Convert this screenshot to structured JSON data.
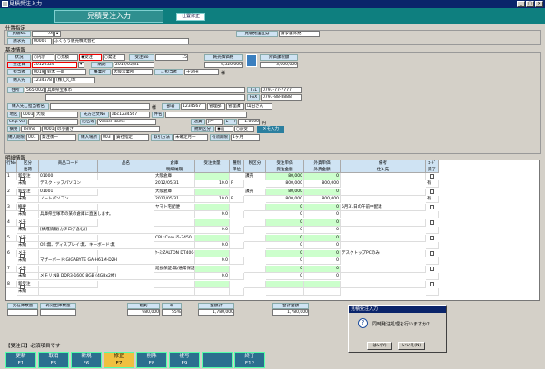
{
  "window": {
    "title": "見積受注入力",
    "min": "_",
    "max": "□",
    "close": "×"
  },
  "header": {
    "title": "見積受注入力",
    "mode": "仕置修正"
  },
  "sec_client": {
    "title": "仕置指定",
    "hinban_label": "見積No",
    "hinban_val": "24",
    "kyoten_label": "請求先",
    "kyoten_code": "00001",
    "kyoten_name": "ふくろう販売株式会社",
    "bunrui_label": "見積発送区分",
    "bunrui_val": "請求書外発"
  },
  "sec_basic": {
    "title": "基本情報",
    "status_label": "状況",
    "status_opts": [
      "内示",
      "見積",
      "受注",
      "発注"
    ],
    "juchu_no_label": "受注No",
    "juchu_no": "15",
    "kingaku_label": "純売価価格",
    "kingaku": "4,520,000",
    "zei_label": "外価課税額",
    "zei": "3,000,000",
    "uketsuke_label": "受注日",
    "uketsuke": "20120524",
    "nouki_label": "納期",
    "nouki": "2012/05/31",
    "tanto_label": "担当者",
    "tanto_code": "0019",
    "tanto_name": "鈴木 一郎",
    "jigyo_label": "事業所",
    "jigyo_val": "大阪営業所",
    "kokyaku_label": "ご担当者",
    "kokyaku_val": "千津田",
    "sama": "様",
    "nonyu_label": "納入先",
    "nonyu_code": "1234578",
    "nonyu_name": "(株)〇〇本",
    "addr_label": "住所",
    "zip": "565-0022",
    "addr": "兵庫県宝塚市",
    "tel_label": "TEL",
    "tel": "0797-77-7777",
    "fax_label": "FAX",
    "fax": "0797-88-8888",
    "nonyu_tanto_label": "納入先ご担当者名",
    "nonyu_tanto_sama": "様",
    "busho_label": "部署",
    "busho_code": "1234567",
    "busho_name": "管理部",
    "yakushoku": "管理課",
    "yakushoku_name": "山田さん",
    "chiku_label": "地区",
    "chiku_code": "0001",
    "chiku_name": "大阪",
    "senpo_label": "先方注文No",
    "senpo_val": "abc1234567",
    "kenmei_label": "件名",
    "ship_label": "Ship Via",
    "ship_val": "",
    "vessel_label": "船名等",
    "vessel_val": "Vessel Name",
    "tsuka_label": "通貨",
    "tsuka_val": "JPY",
    "rate_label": "レート",
    "rate_val": "1.0000",
    "en": "円",
    "tekiyo_label": "摘要",
    "tekiyo_val": "Terms",
    "tekiyo_code": "0001",
    "tekiyo_name": "の小書き",
    "saiken_label": "規制区分",
    "saiken_opts": [
      "前",
      "前受"
    ],
    "memo_btn": "メモ入力",
    "nonyu_kubun_label": "納入期限",
    "nonyu_kubun_code": "001",
    "nonyu_kubun_name": "発注後一",
    "nonyu_basho_label": "納入場所",
    "nonyu_basho_code": "003",
    "nonyu_basho_name": "貴社指定",
    "torihiki_label": "取引方法",
    "torihiki_val": "未確定月一",
    "yuko_label": "有効期限",
    "yuko_val": "1ヶ月"
  },
  "detail": {
    "title": "明細情報",
    "headers": {
      "no": "行No",
      "kubun": "区分\n出荷",
      "code": "商品コード",
      "name2": "品名２",
      "name": "品名",
      "unit": "倉庫\n明細納期",
      "qty": "受注数量",
      "shubetsu": "種別\n単位",
      "zei": "税区分",
      "tanka": "受注単価\n受注金額",
      "gaika": "外貨単価\n外貨金額",
      "biko": "備考\n仕入先",
      "chk": "ｺｰﾄﾞ\n完了"
    },
    "rows": [
      {
        "no": "1",
        "kubun": "新受注",
        "shuka": "未納",
        "code": "01000",
        "name": "デスクトップパソコン",
        "soko": "大阪倉庫",
        "nouki": "2012/05/31",
        "qty": "10.0",
        "unit": "P",
        "zei": "課売",
        "tanka": "80,000",
        "kin": "800,000",
        "gaika": "0",
        "gkin": "800,000",
        "biko": "",
        "chk": "有"
      },
      {
        "no": "2",
        "kubun": "新受注",
        "shuka": "未納",
        "code": "01001",
        "name": "ノートパソコン",
        "soko": "大阪倉庫",
        "nouki": "2012/05/31",
        "qty": "10.0",
        "unit": "P",
        "zei": "課売",
        "tanka": "80,000",
        "kin": "800,000",
        "gaika": "0",
        "gkin": "800,000",
        "biko": "",
        "chk": "有"
      },
      {
        "no": "3",
        "kubun": "摘要",
        "shuka": "未納",
        "code": "",
        "name": "兵庫県宝塚市の某の倉庫に直送します。",
        "soko": "ヤマト宅配便",
        "nouki": "",
        "qty": "0.0",
        "unit": "",
        "zei": "",
        "tanka": "0",
        "kin": "0",
        "gaika": "0",
        "gkin": "0",
        "biko": "5月31日の午前中配達",
        "chk": ""
      },
      {
        "no": "4",
        "kubun": "メモ",
        "shuka": "未納",
        "code": "",
        "name": "[構成情報(カタログ含む)]",
        "soko": "",
        "nouki": "",
        "qty": "0.0",
        "unit": "",
        "zei": "",
        "tanka": "0",
        "kin": "0",
        "gaika": "0",
        "gkin": "0",
        "biko": "",
        "chk": ""
      },
      {
        "no": "5",
        "kubun": "メモ",
        "shuka": "未納",
        "code": "",
        "name": "OS:無、ディスプレイ:無、キーボード:無",
        "soko": "CPU:Core i5-3450",
        "nouki": "",
        "qty": "0.0",
        "unit": "",
        "zei": "",
        "tanka": "0",
        "kin": "0",
        "gaika": "0",
        "gkin": "0",
        "biko": "",
        "chk": ""
      },
      {
        "no": "6",
        "kubun": "メモ",
        "shuka": "未納",
        "code": "",
        "name": "マザーボード:GIGABYTE GA-H61M-D2H",
        "soko": "ｹｰｽ:ZALTON DT400-BK",
        "nouki": "",
        "qty": "0.0",
        "unit": "",
        "zei": "",
        "tanka": "0",
        "kin": "0",
        "gaika": "0",
        "gkin": "0",
        "biko": "デスクトップPCのみ",
        "chk": ""
      },
      {
        "no": "7",
        "kubun": "メモ",
        "shuka": "未納",
        "code": "",
        "name": "メモリ:NB DDR3-1600 8GB (4GBx2枚)",
        "soko": "延長保証:無/通常保証",
        "nouki": "",
        "qty": "0.0",
        "unit": "",
        "zei": "",
        "tanka": "0",
        "kin": "0",
        "gaika": "0",
        "gkin": "0",
        "biko": "",
        "chk": ""
      },
      {
        "no": "8",
        "kubun": "新受注",
        "shuka": "未納",
        "code": "",
        "name": "",
        "soko": "",
        "nouki": "",
        "qty": "",
        "unit": "",
        "zei": "",
        "tanka": "",
        "kin": "",
        "gaika": "",
        "gkin": "",
        "biko": "",
        "chk": ""
      }
    ]
  },
  "totals": {
    "juchu_label": "実在庫数量",
    "yuko_label": "有効出庫数量",
    "ararieki_label": "粗利",
    "ritsu_label": "率",
    "kingaku_label": "金額計",
    "gokei_label": "合計金額",
    "ararieki": "980,000",
    "ritsu": "55%",
    "kingaku": "1,780,000",
    "gokei": "1,780,000"
  },
  "status_msg": "【受注日】必須項目です",
  "fkeys": [
    {
      "label": "更新",
      "key": "F1"
    },
    {
      "label": "取消",
      "key": "F5"
    },
    {
      "label": "新規",
      "key": "F6"
    },
    {
      "label": "修正",
      "key": "F7"
    },
    {
      "label": "削除",
      "key": "F8"
    },
    {
      "label": "複写",
      "key": "F9"
    },
    {
      "label": "",
      "key": ""
    },
    {
      "label": "終了",
      "key": "F12"
    }
  ],
  "dialog": {
    "title": "見積受注入力",
    "message": "同時発注処理を行いますか？",
    "yes": "はい(Y)",
    "no": "いいえ(N)"
  },
  "colors": {
    "header_bg": "#0e7f7f",
    "fkey_bg": "#2b6f8f",
    "highlight": "#ccffcc"
  }
}
